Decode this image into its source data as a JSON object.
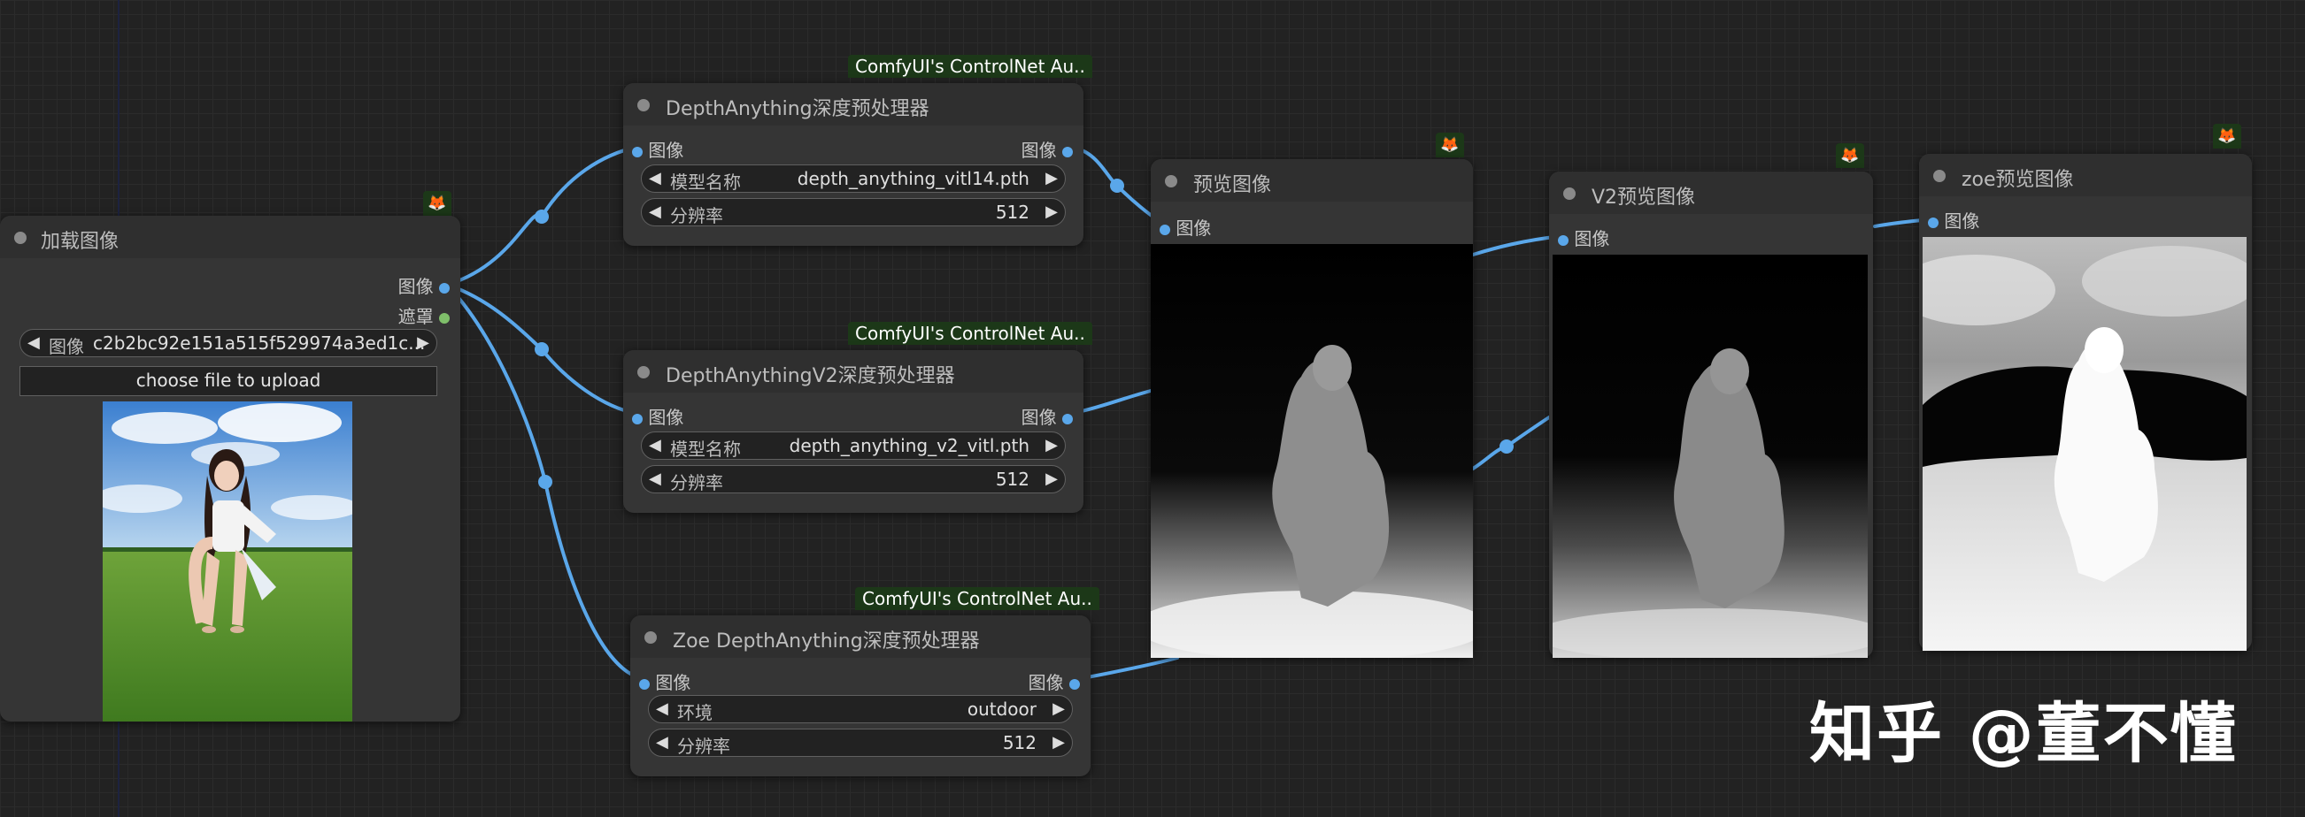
{
  "badges": {
    "depth_anything": "ComfyUI's ControlNet Au..",
    "depth_anything_v2": "ComfyUI's ControlNet Au..",
    "zoe": "ComfyUI's ControlNet Au.."
  },
  "load_image_node": {
    "title": "加载图像",
    "outputs": [
      "图像",
      "遮罩"
    ],
    "image_widget": {
      "label": "图像",
      "value": "c2b2bc92e151a515f529974a3ed1c..."
    },
    "upload_label": "choose file to upload"
  },
  "depth_anything_node": {
    "title": "DepthAnything深度预处理器",
    "input": "图像",
    "output": "图像",
    "widgets": [
      {
        "label": "模型名称",
        "value": "depth_anything_vitl14.pth"
      },
      {
        "label": "分辨率",
        "value": "512"
      }
    ]
  },
  "depth_anything_v2_node": {
    "title": "DepthAnythingV2深度预处理器",
    "input": "图像",
    "output": "图像",
    "widgets": [
      {
        "label": "模型名称",
        "value": "depth_anything_v2_vitl.pth"
      },
      {
        "label": "分辨率",
        "value": "512"
      }
    ]
  },
  "zoe_node": {
    "title": "Zoe DepthAnything深度预处理器",
    "input": "图像",
    "output": "图像",
    "widgets": [
      {
        "label": "环境",
        "value": "outdoor"
      },
      {
        "label": "分辨率",
        "value": "512"
      }
    ]
  },
  "preview_node": {
    "title": "预览图像",
    "input": "图像"
  },
  "v2_preview_node": {
    "title": "V2预览图像",
    "input": "图像"
  },
  "zoe_preview_node": {
    "title": "zoe预览图像",
    "input": "图像"
  },
  "watermark": "知乎 @董不懂",
  "colors": {
    "wire": "#5aa7ea",
    "badge_bg": "#1c3818",
    "node_bg": "#353535",
    "canvas_bg": "#222222"
  },
  "icons": {
    "fox": "fox-icon",
    "arrow_left": "◀",
    "arrow_right": "▶"
  }
}
